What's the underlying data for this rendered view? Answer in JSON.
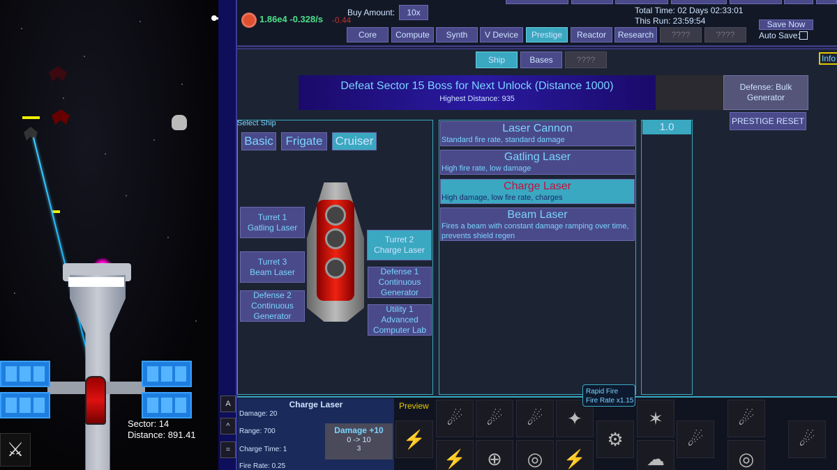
{
  "resource": {
    "value": "1.86e4 -0.328/s",
    "delta": "-0.44"
  },
  "buy": {
    "label": "Buy Amount:",
    "amount": "10x"
  },
  "tabs": [
    "Core",
    "Compute",
    "Synth",
    "V Device",
    "Prestige",
    "Reactor",
    "Research",
    "????",
    "????"
  ],
  "time": {
    "total": "Total Time: 02 Days 02:33:01",
    "run": "This Run: 23:59:54"
  },
  "save": {
    "button": "Save Now",
    "auto": "Auto Save:"
  },
  "subtabs": [
    "Ship",
    "Bases",
    "????"
  ],
  "info": "Info",
  "unlock": {
    "title": "Defeat Sector 15 Boss for Next Unlock (Distance 1000)",
    "sub": "Highest Distance: 935"
  },
  "defense_bulk": "Defense: Bulk Generator",
  "prestige_reset": "PRESTIGE RESET",
  "select_ship": "Select Ship",
  "ships": [
    "Basic",
    "Frigate",
    "Cruiser"
  ],
  "slots": {
    "t1": [
      "Turret 1",
      "Gatling Laser"
    ],
    "t3": [
      "Turret 3",
      "Beam Laser"
    ],
    "d2": [
      "Defense 2",
      "Continuous",
      "Generator"
    ],
    "t2": [
      "Turret 2",
      "Charge Laser"
    ],
    "d1": [
      "Defense 1",
      "Continuous",
      "Generator"
    ],
    "u1": [
      "Utility 1",
      "Advanced",
      "Computer Lab"
    ]
  },
  "weapons": [
    {
      "name": "Laser Cannon",
      "desc": "Standard fire rate, standard damage"
    },
    {
      "name": "Gatling Laser",
      "desc": "High fire rate, low damage"
    },
    {
      "name": "Charge Laser",
      "desc": "High damage, low fire rate, charges"
    },
    {
      "name": "Beam Laser",
      "desc": "Fires a beam with constant damage ramping over time, prevents shield regen"
    }
  ],
  "multiplier": "1.0",
  "stats": {
    "title": "Charge Laser",
    "damage": "Damage: 20",
    "range": "Range: 700",
    "charge": "Charge Time: 1",
    "fire": "Fire Rate: 0.25"
  },
  "upgrade": {
    "title": "Damage +10",
    "range": "0 -> 10",
    "cost": "3"
  },
  "preview": "Preview",
  "tooltip": {
    "line1": "Rapid Fire",
    "line2": "Fire Rate x1.15"
  },
  "sector": {
    "sector": "Sector: 14",
    "distance": "Distance: 891.41"
  },
  "side_buttons": [
    "A",
    "^",
    "="
  ]
}
